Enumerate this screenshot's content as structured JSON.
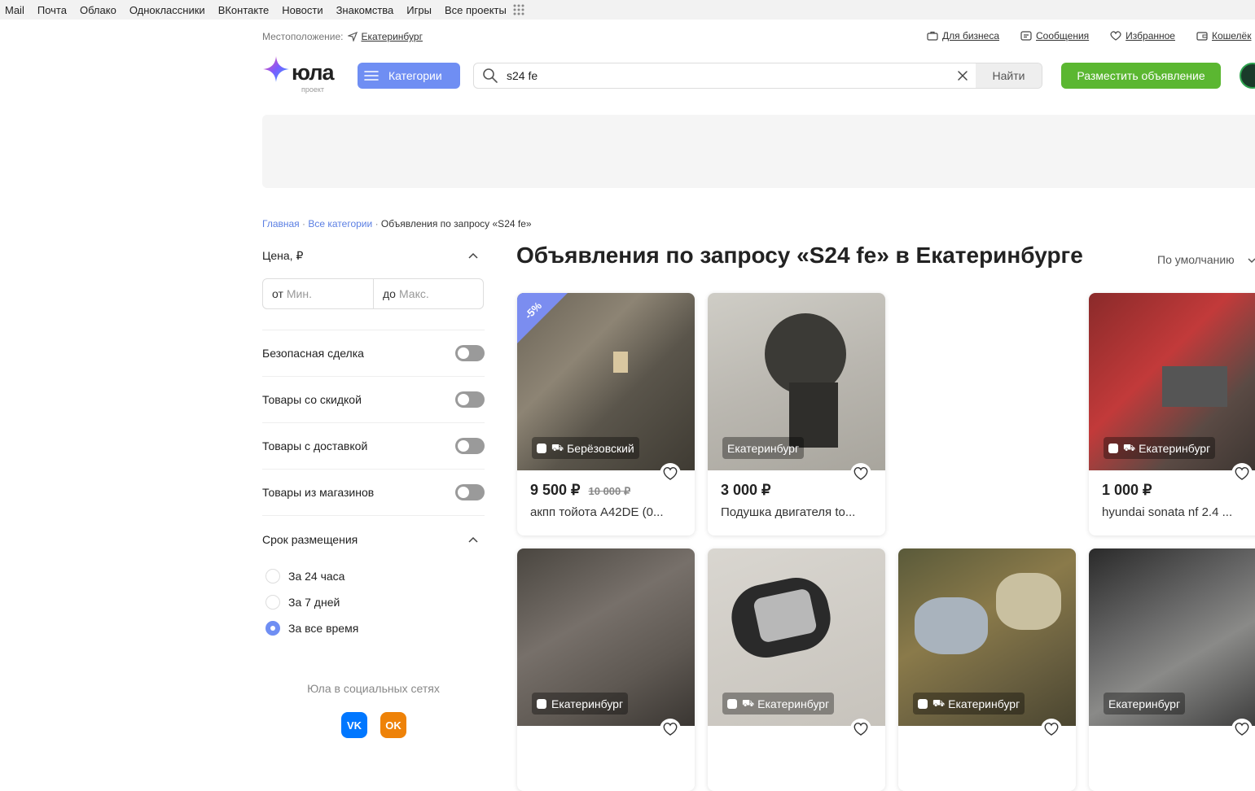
{
  "portal": {
    "items": [
      "Mail",
      "Почта",
      "Облако",
      "Одноклассники",
      "ВКонтакте",
      "Новости",
      "Знакомства",
      "Игры",
      "Все проекты"
    ]
  },
  "location": {
    "label": "Местоположение:",
    "city": "Екатеринбург"
  },
  "top_links": {
    "business": "Для бизнеса",
    "messages": "Сообщения",
    "favorites": "Избранное",
    "wallet": "Кошелёк"
  },
  "logo": {
    "word": "юла",
    "sub": "проект"
  },
  "header": {
    "categories_label": "Категории",
    "search_value": "s24 fe",
    "find_label": "Найти",
    "post_label": "Разместить объявление"
  },
  "breadcrumbs": {
    "home": "Главная",
    "all": "Все категории",
    "current": "Объявления по запросу «S24 fe»",
    "sep": "·"
  },
  "filters": {
    "price_title": "Цена, ₽",
    "from_prefix": "от",
    "from_placeholder": "Мин.",
    "to_prefix": "до",
    "to_placeholder": "Макс.",
    "toggles": [
      "Безопасная сделка",
      "Товары со скидкой",
      "Товары с доставкой",
      "Товары из магазинов"
    ],
    "period_title": "Срок размещения",
    "periods": [
      "За 24 часа",
      "За 7 дней",
      "За все время"
    ],
    "selected_period": "За все время"
  },
  "social": {
    "title": "Юла в социальных сетях",
    "vk": "VK",
    "ok": "OK"
  },
  "main": {
    "heading": "Объявления по запросу «S24 fe» в Екатеринбурге",
    "sort_label": "По умолчанию"
  },
  "cards": [
    {
      "location": "Берёзовский",
      "price": "9 500 ₽",
      "old_price": "10 000 ₽",
      "title": "акпп тойота A42DE (0...",
      "discount": "-5%"
    },
    {
      "location": "Екатеринбург",
      "price": "3 000 ₽",
      "old_price": "",
      "title": "Подушка двигателя to...",
      "discount": ""
    },
    {
      "location": "Екатеринбург",
      "price": "1 000 ₽",
      "old_price": "",
      "title": "hyundai sonata nf 2.4 ...",
      "discount": ""
    },
    {
      "location": "Екатеринбург",
      "price": "",
      "old_price": "",
      "title": "",
      "discount": ""
    },
    {
      "location": "Екатеринбург",
      "price": "",
      "old_price": "",
      "title": "",
      "discount": ""
    },
    {
      "location": "Екатеринбург",
      "price": "",
      "old_price": "",
      "title": "",
      "discount": ""
    },
    {
      "location": "Екатеринбург",
      "price": "",
      "old_price": "",
      "title": "",
      "discount": ""
    }
  ],
  "colors": {
    "accent": "#6f8ef3",
    "green": "#5bb731",
    "vk": "#0077ff",
    "ok": "#ee8208"
  }
}
